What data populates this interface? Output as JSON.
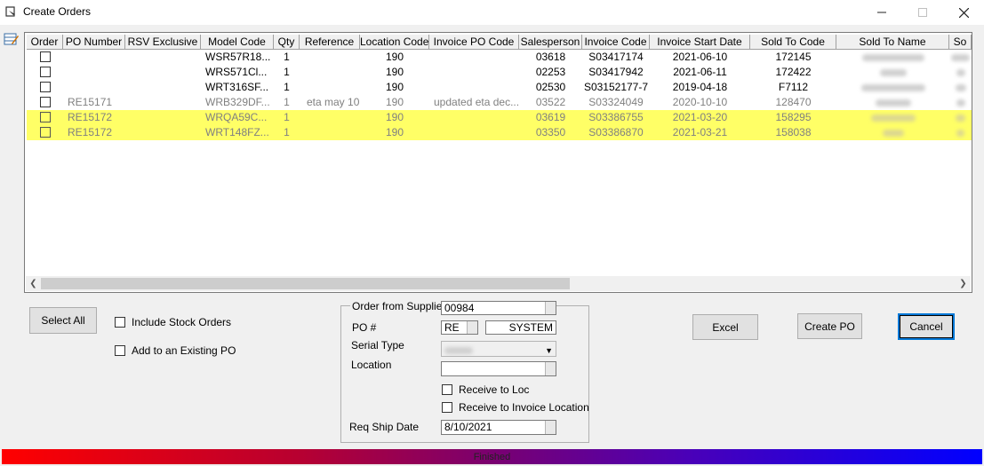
{
  "window": {
    "title": "Create Orders"
  },
  "grid": {
    "columns": [
      {
        "label": "Order",
        "w": 41
      },
      {
        "label": "PO Number",
        "w": 70
      },
      {
        "label": "RSV Exclusive",
        "w": 85
      },
      {
        "label": "Model Code",
        "w": 82
      },
      {
        "label": "Qty",
        "w": 29
      },
      {
        "label": "Reference",
        "w": 68
      },
      {
        "label": "Location Code",
        "w": 78
      },
      {
        "label": "Invoice PO Code",
        "w": 101
      },
      {
        "label": "Salesperson",
        "w": 71
      },
      {
        "label": "Invoice Code",
        "w": 76
      },
      {
        "label": "Invoice Start Date",
        "w": 113
      },
      {
        "label": "Sold To Code",
        "w": 97
      },
      {
        "label": "Sold To Name",
        "w": 127
      },
      {
        "label": "So",
        "w": 25
      }
    ],
    "rows": [
      {
        "style": "normal",
        "po_number": "",
        "rsv": "",
        "model": "WSR57R18...",
        "qty": "1",
        "reference": "",
        "location": "190",
        "invoice_po": "",
        "salesperson": "03618",
        "invoice_code": "S03417174",
        "invoice_start": "2021-06-10",
        "sold_to_code": "172145"
      },
      {
        "style": "normal",
        "po_number": "",
        "rsv": "",
        "model": "WRS571Cl...",
        "qty": "1",
        "reference": "",
        "location": "190",
        "invoice_po": "",
        "salesperson": "02253",
        "invoice_code": "S03417942",
        "invoice_start": "2021-06-11",
        "sold_to_code": "172422"
      },
      {
        "style": "normal",
        "po_number": "",
        "rsv": "",
        "model": "WRT316SF...",
        "qty": "1",
        "reference": "",
        "location": "190",
        "invoice_po": "",
        "salesperson": "02530",
        "invoice_code": "S03152177-7",
        "invoice_start": "2019-04-18",
        "sold_to_code": "F7112"
      },
      {
        "style": "gray",
        "po_number": "RE15171",
        "rsv": "",
        "model": "WRB329DF...",
        "qty": "1",
        "reference": "eta may 10",
        "location": "190",
        "invoice_po": "updated eta dec...",
        "salesperson": "03522",
        "invoice_code": "S03324049",
        "invoice_start": "2020-10-10",
        "sold_to_code": "128470"
      },
      {
        "style": "yellow",
        "po_number": "RE15172",
        "rsv": "",
        "model": "WRQA59C...",
        "qty": "1",
        "reference": "",
        "location": "190",
        "invoice_po": "",
        "salesperson": "03619",
        "invoice_code": "S03386755",
        "invoice_start": "2021-03-20",
        "sold_to_code": "158295"
      },
      {
        "style": "yellow",
        "po_number": "RE15172",
        "rsv": "",
        "model": "WRT148FZ...",
        "qty": "1",
        "reference": "",
        "location": "190",
        "invoice_po": "",
        "salesperson": "03350",
        "invoice_code": "S03386870",
        "invoice_start": "2021-03-21",
        "sold_to_code": "158038"
      }
    ]
  },
  "buttons": {
    "select_all": "Select All",
    "excel": "Excel",
    "create_po": "Create PO",
    "cancel": "Cancel"
  },
  "checkboxes": {
    "include_stock": "Include Stock Orders",
    "add_existing": "Add to an Existing PO"
  },
  "supplier_group": {
    "legend": "Order from Supplier",
    "supplier_value": "00984",
    "po_label": "PO #",
    "po_prefix": "RE",
    "po_system": "SYSTEM",
    "serial_type_label": "Serial Type",
    "location_label": "Location",
    "location_value": "",
    "receive_to_loc": "Receive to Loc",
    "receive_to_invoice_loc": "Receive to Invoice Location",
    "req_ship_date_label": "Req Ship Date",
    "req_ship_date_value": "8/10/2021"
  },
  "status": {
    "text": "Finished"
  }
}
